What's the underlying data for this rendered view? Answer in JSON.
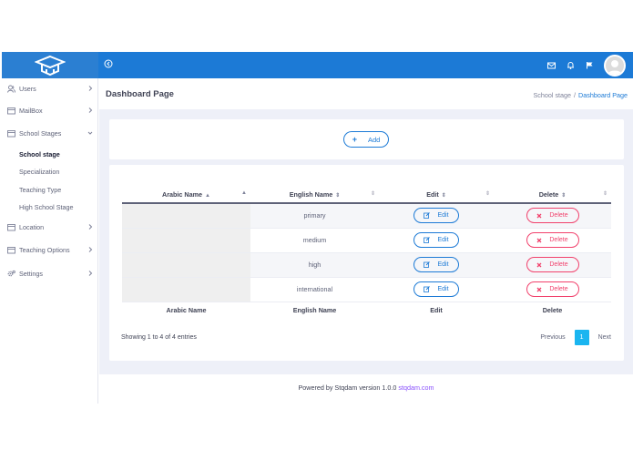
{
  "topbar": {
    "accent": "#1c7ad6",
    "logo_icon": "graduation-cap-icon",
    "icons": [
      "mail-icon",
      "bell-icon",
      "flag-icon"
    ]
  },
  "sidebar": {
    "items": [
      {
        "label": "Users",
        "icon": "users-icon"
      },
      {
        "label": "MailBox",
        "icon": "mailbox-icon"
      },
      {
        "label": "School Stages",
        "icon": "folder-icon"
      },
      {
        "label": "Location",
        "icon": "folder-icon"
      },
      {
        "label": "Teaching Options",
        "icon": "folder-icon"
      },
      {
        "label": "Settings",
        "icon": "gear-icon"
      }
    ],
    "sub_items": [
      "School stage",
      "Specialization",
      "Teaching Type",
      "High School Stage"
    ]
  },
  "header": {
    "title": "Dashboard Page",
    "breadcrumb": [
      "School stage",
      "Dashboard Page"
    ],
    "breadcrumb_sep": "/"
  },
  "add_button": {
    "label": "Add",
    "icon": "+"
  },
  "table": {
    "headers": [
      "Arabic Name",
      "English Name",
      "Edit",
      "Delete"
    ],
    "rows": [
      {
        "arabic": "",
        "english": "primary",
        "edit": "Edit",
        "delete": "Delete"
      },
      {
        "arabic": "",
        "english": "medium",
        "edit": "Edit",
        "delete": "Delete"
      },
      {
        "arabic": "",
        "english": "high",
        "edit": "Edit",
        "delete": "Delete"
      },
      {
        "arabic": "",
        "english": "international",
        "edit": "Edit",
        "delete": "Delete"
      }
    ],
    "footer_headers": [
      "Arabic Name",
      "English Name",
      "Edit",
      "Delete"
    ]
  },
  "pagination": {
    "info": "Showing 1 to 4 of 4 entries",
    "previous": "Previous",
    "current": "1",
    "next": "Next"
  },
  "footer": {
    "text": "Powered by Stqdam version 1.0.0",
    "link": "stqdam.com"
  }
}
